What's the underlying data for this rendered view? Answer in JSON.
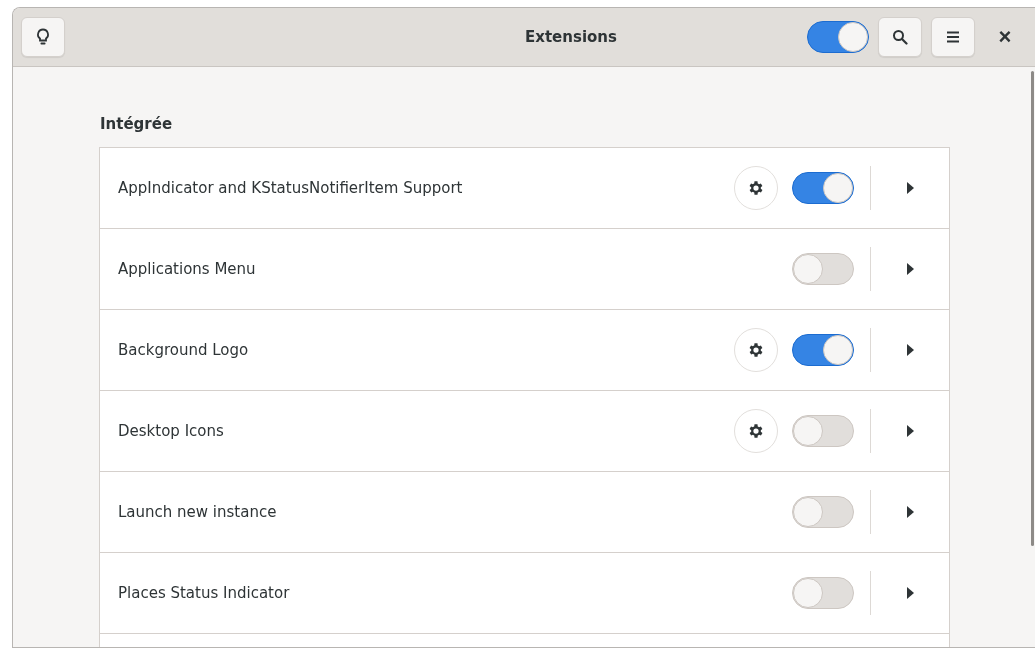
{
  "window": {
    "title": "Extensions",
    "close_label": "×"
  },
  "header": {
    "extensions_enabled": true
  },
  "section": {
    "title": "Intégrée"
  },
  "extensions": [
    {
      "name": "AppIndicator and KStatusNotifierItem Support",
      "has_settings": true,
      "enabled": true
    },
    {
      "name": "Applications Menu",
      "has_settings": false,
      "enabled": false
    },
    {
      "name": "Background Logo",
      "has_settings": true,
      "enabled": true
    },
    {
      "name": "Desktop Icons",
      "has_settings": true,
      "enabled": false
    },
    {
      "name": "Launch new instance",
      "has_settings": false,
      "enabled": false
    },
    {
      "name": "Places Status Indicator",
      "has_settings": false,
      "enabled": false
    }
  ]
}
